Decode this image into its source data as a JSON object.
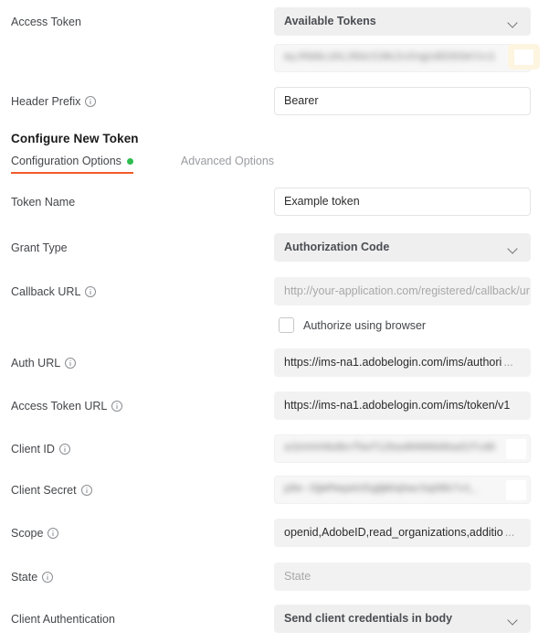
{
  "panel": {
    "section_title": "Configure New Token"
  },
  "access_token": {
    "label": "Access Token",
    "dropdown_value": "Available Tokens",
    "token_value": "eyJhbGciOiJSUzI1NiIsIng1dSI6Imltc19uYTEta2V5LWF0MS5jZXIiLCJ",
    "copy_button": "copy"
  },
  "header_prefix": {
    "label": "Header Prefix",
    "value": "Bearer"
  },
  "tabs": [
    {
      "label": "Configuration Options",
      "active": true,
      "has_dot": true
    },
    {
      "label": "Advanced Options",
      "active": false,
      "has_dot": false
    }
  ],
  "fields": {
    "token_name": {
      "label": "Token Name",
      "value": "Example token"
    },
    "grant_type": {
      "label": "Grant Type",
      "value": "Authorization Code"
    },
    "callback_url": {
      "label": "Callback URL",
      "placeholder": "http://your-application.com/registered/callback/url"
    },
    "authorize_browser": {
      "label": "Authorize using browser",
      "checked": false
    },
    "auth_url": {
      "label": "Auth URL",
      "value": "https://ims-na1.adobelogin.com/ims/authori",
      "ellipsis": "..."
    },
    "access_token_url": {
      "label": "Access Token URL",
      "value": "https://ims-na1.adobelogin.com/ims/token/v1"
    },
    "client_id": {
      "label": "Client ID",
      "value": "a1b4444bdbcfbef12bad0000b0bad1fcd01ab"
    },
    "client_secret": {
      "label": "Client Secret",
      "value": "p8e-2QmPmqakU5gQWUqhwc5qO8b7v1_"
    },
    "scope": {
      "label": "Scope",
      "value": "openid,AdobeID,read_organizations,additio",
      "ellipsis": "..."
    },
    "state": {
      "label": "State",
      "placeholder": "State"
    },
    "client_authentication": {
      "label": "Client Authentication",
      "value": "Send client credentials in body"
    }
  },
  "colors": {
    "accent": "#f15a2b",
    "status_green": "#2ebd4e",
    "field_gray": "#f2f2f2",
    "highlight_cream": "#fdf5e0"
  }
}
